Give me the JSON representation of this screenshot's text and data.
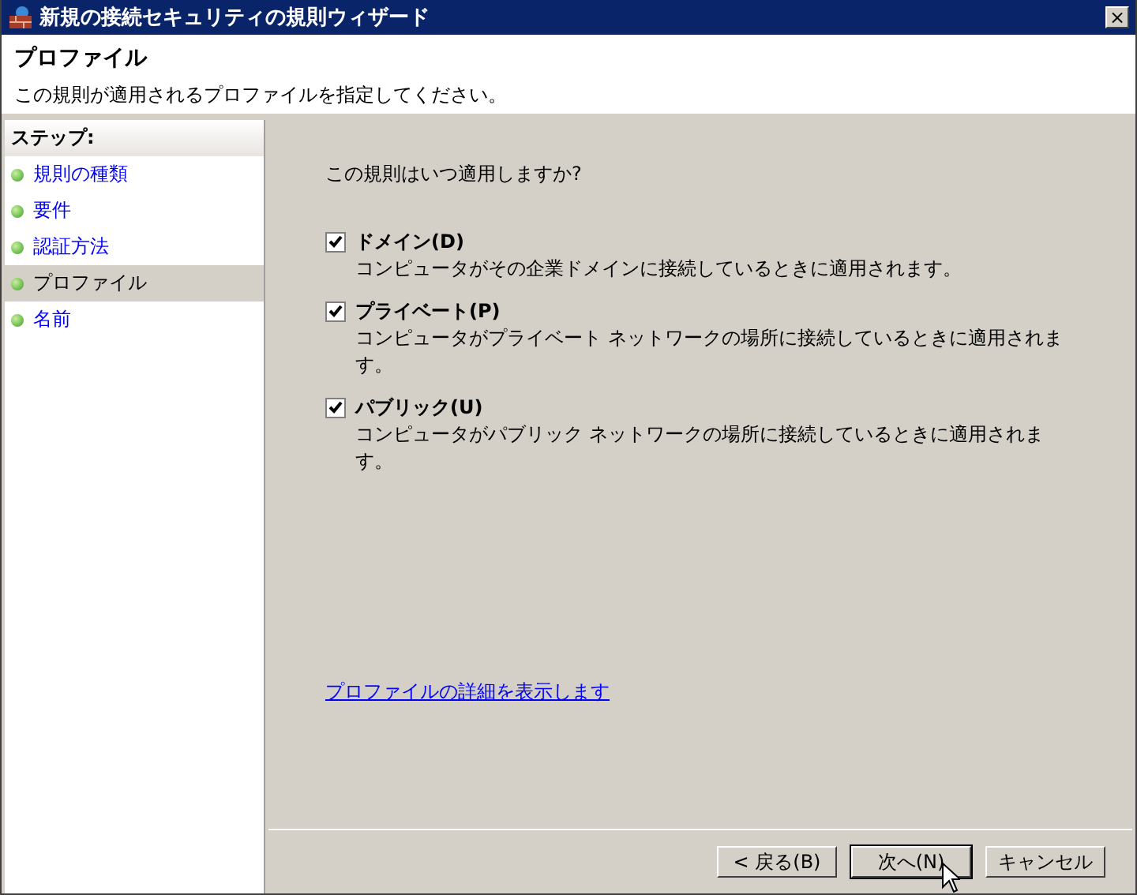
{
  "window": {
    "title": "新規の接続セキュリティの規則ウィザード",
    "close": "×"
  },
  "header": {
    "title": "プロファイル",
    "subtitle": "この規則が適用されるプロファイルを指定してください。"
  },
  "sidebar": {
    "heading": "ステップ:",
    "items": [
      {
        "label": "規則の種類",
        "selected": false
      },
      {
        "label": "要件",
        "selected": false
      },
      {
        "label": "認証方法",
        "selected": false
      },
      {
        "label": "プロファイル",
        "selected": true
      },
      {
        "label": "名前",
        "selected": false
      }
    ]
  },
  "content": {
    "question": "この規則はいつ適用しますか?",
    "options": [
      {
        "label": "ドメイン(D)",
        "description": "コンピュータがその企業ドメインに接続しているときに適用されます。",
        "checked": true
      },
      {
        "label": "プライベート(P)",
        "description": "コンピュータがプライベート ネットワークの場所に接続しているときに適用されます。",
        "checked": true
      },
      {
        "label": "パブリック(U)",
        "description": "コンピュータがパブリック ネットワークの場所に接続しているときに適用されます。",
        "checked": true
      }
    ],
    "link": "プロファイルの詳細を表示します"
  },
  "buttons": [
    {
      "label": "< 戻る(B)",
      "default": false
    },
    {
      "label": "次へ(N)",
      "default": true
    },
    {
      "label": "キャンセル",
      "default": false
    }
  ]
}
